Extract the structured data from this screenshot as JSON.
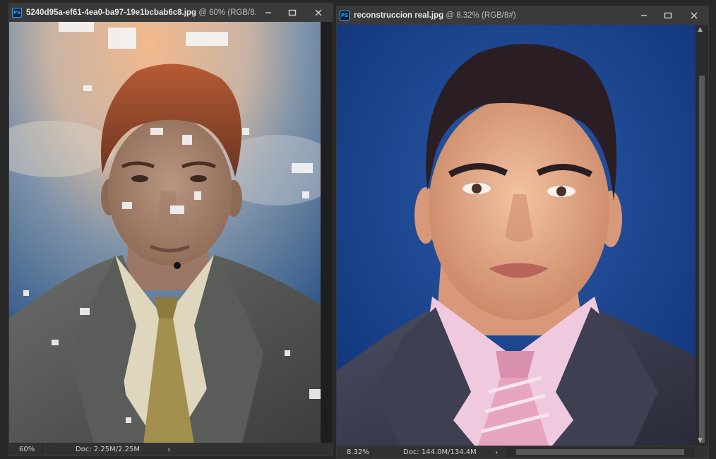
{
  "windows": [
    {
      "title": "5240d95a-ef61-4ea0-ba97-19e1bcbab6c8.jpg",
      "title_suffix": " @ 60% (RGB/8...",
      "zoom": "60%",
      "doc": "Doc: 2.25M/2.25M"
    },
    {
      "title": "reconstruccion real.jpg",
      "title_suffix": " @ 8.32% (RGB/8#)",
      "zoom": "8.32%",
      "doc": "Doc: 144.0M/134.4M"
    }
  ],
  "icons": {
    "app": "PS",
    "minimize": "minimize-icon",
    "restore": "restore-icon",
    "close": "close-icon",
    "chevron": "›"
  },
  "colors": {
    "titlebar": "#3a3a3a",
    "ps_blue": "#31a8ff",
    "backdrop_blue": "#123a8c"
  }
}
